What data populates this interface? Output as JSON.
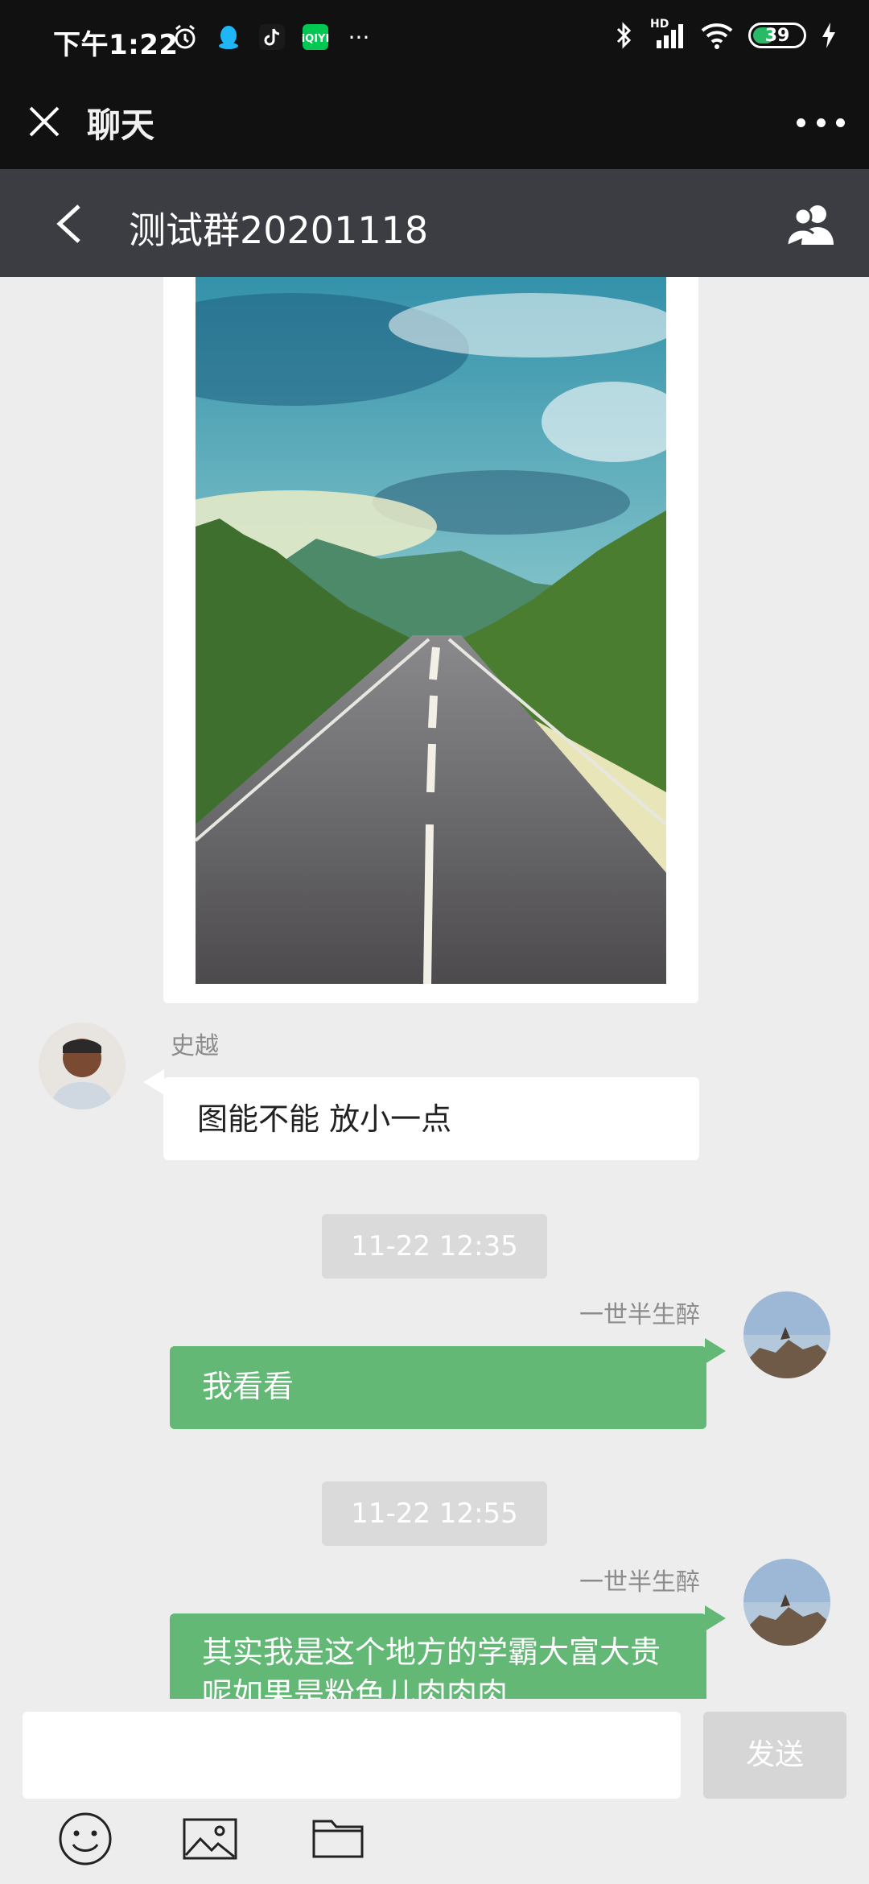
{
  "status_bar": {
    "time": "下午1:22",
    "battery": "39",
    "network": "HD",
    "more": "···"
  },
  "header": {
    "title": "聊天"
  },
  "group": {
    "title": "测试群20201118"
  },
  "messages": [
    {
      "sender": "史越",
      "text": "图能不能 放小一点"
    },
    {
      "timestamp": "11-22 12:35"
    },
    {
      "sender": "一世半生醉",
      "text": "我看看"
    },
    {
      "timestamp": "11-22 12:55"
    },
    {
      "sender": "一世半生醉",
      "text": "其实我是这个地方的学霸大富大贵呢如果是粉色儿肉肉肉"
    }
  ],
  "composer": {
    "placeholder": "",
    "send_label": "发送"
  },
  "colors": {
    "outgoing_bubble": "#62b874",
    "group_bar": "#3b3d42",
    "background": "#ededed"
  }
}
